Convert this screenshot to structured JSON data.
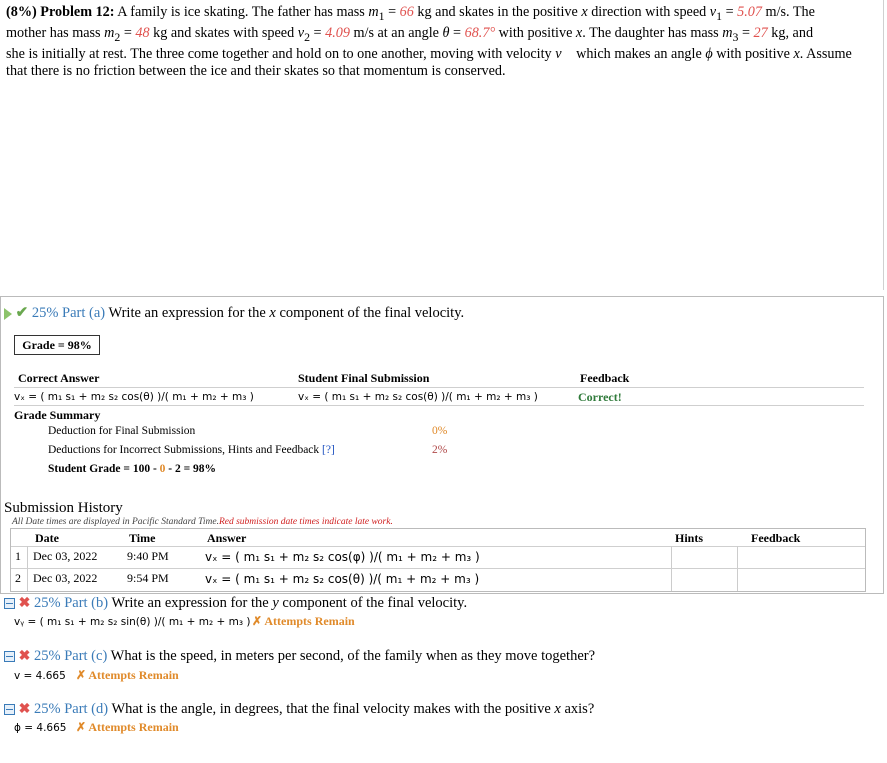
{
  "problem": {
    "weight": "(8%)",
    "title": "Problem 12:",
    "line1_a": "A family is ice skating. The father has mass ",
    "m1": "m",
    "m1_sub": "1",
    "eq": " = ",
    "m1_val": "66",
    "line1_b": " kg and skates in the positive ",
    "x": "x",
    "line1_c": " direction with speed ",
    "v1": "v",
    "v1_sub": "1",
    "v1_val": "5.07",
    "line1_d": " m/s. The",
    "line2_a": "mother has mass ",
    "m2_val": "48",
    "line2_b": " kg and skates with speed ",
    "v2_val": "4.09",
    "line2_c": " m/s at an angle ",
    "theta": "θ",
    "theta_val": "68.7°",
    "line2_d": " with positive ",
    "line2_e": ". The daughter has mass ",
    "m3_val": "27",
    "line2_f": " kg, and",
    "line3": "she is initially at rest. The three come together and hold on to one another, moving with velocity ",
    "vvec": "v⃗",
    "line3_b": " which makes an angle ",
    "phi": "ϕ",
    "line3_c": " with positive ",
    "line3_d": ". Assume",
    "line4": "that there is no friction between the ice and their skates so that momentum is conserved."
  },
  "part_a": {
    "percent": "25%",
    "label": "Part (a)",
    "question_a": "Write an expression for the ",
    "question_b": " component of the final velocity.",
    "grade": "Grade = 98%",
    "col_correct": "Correct Answer",
    "col_student": "Student Final Submission",
    "col_feedback": "Feedback",
    "correct_formula": "vₓ = ( m₁ s₁ + m₂ s₂ cos(θ) )/( m₁ + m₂ + m₃ )",
    "student_formula": "vₓ = ( m₁ s₁ + m₂ s₂ cos(θ) )/( m₁ + m₂ + m₃ )",
    "feedback": "Correct!",
    "grade_summary": "Grade Summary",
    "deduction_final": "Deduction for Final Submission",
    "deduction_final_val": "0%",
    "deduction_incorrect": "Deductions for Incorrect Submissions, Hints and Feedback",
    "help_link": "[?]",
    "deduction_incorrect_val": "2%",
    "student_grade_a": "Student Grade = 100 - ",
    "student_grade_b": "0",
    "student_grade_c": " - 2 = 98%"
  },
  "submission_history": {
    "title": "Submission History",
    "note": "All Date times are displayed in Pacific Standard Time.",
    "note_red": "Red submission date times indicate late work.",
    "headers": {
      "date": "Date",
      "time": "Time",
      "answer": "Answer",
      "hints": "Hints",
      "feedback": "Feedback"
    },
    "rows": [
      {
        "num": "1",
        "date": "Dec 03, 2022",
        "time": "9:40 PM",
        "answer": "vₓ = ( m₁ s₁ + m₂ s₂ cos(φ) )/( m₁ + m₂ + m₃ )"
      },
      {
        "num": "2",
        "date": "Dec 03, 2022",
        "time": "9:54 PM",
        "answer": "vₓ = ( m₁ s₁ + m₂ s₂ cos(θ) )/( m₁ + m₂ + m₃ )"
      }
    ]
  },
  "part_b": {
    "percent": "25%",
    "label": "Part (b)",
    "question_a": "Write an expression for the ",
    "var": "y",
    "question_b": " component of the final velocity.",
    "answer": "vᵧ = ( m₁ s₁ + m₂ s₂ sin(θ) )/( m₁ + m₂ + m₃ )",
    "status": "✗ Attempts Remain"
  },
  "part_c": {
    "percent": "25%",
    "label": "Part (c)",
    "question": "What is the speed, in meters per second, of the family when as they move together?",
    "answer": "v = 4.665",
    "status": "✗ Attempts Remain"
  },
  "part_d": {
    "percent": "25%",
    "label": "Part (d)",
    "question_a": "What is the angle, in degrees, that the final velocity makes with the positive ",
    "var": "x",
    "question_b": " axis?",
    "answer": "ϕ = 4.665",
    "status": "✗ Attempts Remain"
  }
}
